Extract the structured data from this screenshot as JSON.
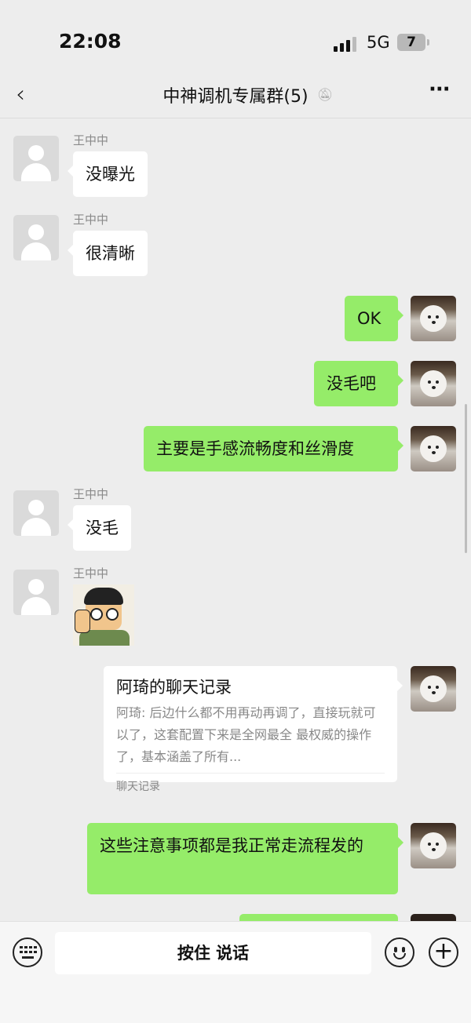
{
  "status": {
    "time": "22:08",
    "network": "5G",
    "battery": "7"
  },
  "nav": {
    "title": "中神调机专属群(5)"
  },
  "messages": [
    {
      "sender": "王中中",
      "text": "没曝光"
    },
    {
      "sender": "王中中",
      "text": "很清晰"
    },
    {
      "text": "OK"
    },
    {
      "text": "没毛吧"
    },
    {
      "text": "主要是手感流畅度和丝滑度"
    },
    {
      "sender": "王中中",
      "text": "没毛"
    },
    {
      "sender": "王中中"
    },
    {
      "card": {
        "title": "阿琦的聊天记录",
        "preview": "阿琦: 后边什么都不用再动再调了，直接玩就可以了，这套配置下来是全网最全 最权威的操作了，基本涵盖了所有...",
        "footer": "聊天记录"
      }
    },
    {
      "text": "这些注意事项都是我正常走流程发的"
    }
  ],
  "input": {
    "voice_label": "按住 说话"
  }
}
